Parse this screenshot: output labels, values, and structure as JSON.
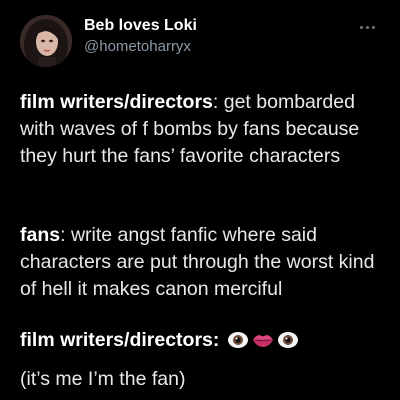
{
  "author": {
    "display_name": "Beb loves Loki",
    "handle": "@hometoharryx"
  },
  "icons": {
    "more": "more-options-icon",
    "emoji_sequence": [
      "eye-emoji-icon",
      "lips-emoji-icon",
      "eye-emoji-icon"
    ]
  },
  "tweet": {
    "p1_label": "film writers/directors",
    "p1_text": ": get bombarded with waves of f bombs by fans because they hurt the fans’ favorite characters",
    "p2_label": "fans",
    "p2_text": ": write angst fanfic where said characters are put through the worst kind of hell it makes canon merciful",
    "p3_label": "film writers/directors",
    "p3_colon": ":",
    "p4_text": "(it’s me I’m the fan)"
  },
  "colors": {
    "background": "#000000",
    "text": "#e7e9ea",
    "secondary": "#8b98a5"
  }
}
